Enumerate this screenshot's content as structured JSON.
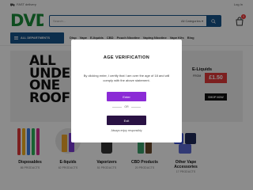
{
  "topbar": {
    "delivery": "FAST delivery",
    "login": "Log In"
  },
  "logo": {
    "text": "DVD",
    "color": "#1a8c3a"
  },
  "search": {
    "placeholder": "Search...",
    "category": "All Categories"
  },
  "cart": {
    "count": "0"
  },
  "nav": {
    "departments": "ALL DEPARTMENTS",
    "links": [
      "Disp",
      "Vape",
      "E-liquids",
      "CBD",
      "Pouch Nicotine",
      "Vaping Nicotine",
      "Vape Kits",
      "Blog"
    ]
  },
  "hero": {
    "headline": [
      "ALL",
      "UNDE",
      "ONE",
      "ROOF"
    ],
    "eliquids": "E-Liquids",
    "from": "FROM",
    "price": "£1.50",
    "shop": "SHOP NOW"
  },
  "categories": [
    {
      "name": "Disposables",
      "count": "86 PRODUCTS"
    },
    {
      "name": "E-liquids",
      "count": "62 PRODUCTS"
    },
    {
      "name": "Vaporizers",
      "count": "51 PRODUCTS"
    },
    {
      "name": "CBD Products",
      "count": "20 PRODUCTS"
    },
    {
      "name": "Other Vape Accessories",
      "count": "17 PRODUCTS"
    }
  ],
  "modal": {
    "title": "AGE VERIFICATION",
    "message": "By clicking enter, I certify that I am over the age of 18 and will comply with the above statement.",
    "enter": "Enter",
    "or": "OR",
    "exit": "Exit",
    "responsibly": "Always enjoy responsibly",
    "enter_color": "#8b2bd6",
    "exit_color": "#2a1244"
  },
  "colors": {
    "brand_blue": "#17548a",
    "price_red": "#e23a3a"
  }
}
